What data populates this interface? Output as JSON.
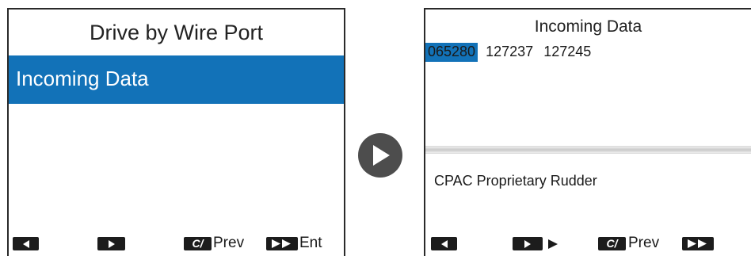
{
  "left_screen": {
    "title": "Drive by Wire Port",
    "menu_item": "Incoming Data",
    "softkeys": {
      "c_key": "C/",
      "prev_label": "Prev",
      "ent_label": "Ent"
    }
  },
  "transition_icon": "play-arrow-icon",
  "right_screen": {
    "title": "Incoming Data",
    "pgn_list": [
      "065280",
      "127237",
      "127245"
    ],
    "selected_pgn_index": 0,
    "description": "CPAC Proprietary Rudder",
    "softkeys": {
      "c_key": "C/",
      "prev_label": "Prev"
    }
  },
  "colors": {
    "highlight": "#1272b8",
    "key_fill": "#1c1c1c",
    "play_circle": "#4d4d4d"
  }
}
